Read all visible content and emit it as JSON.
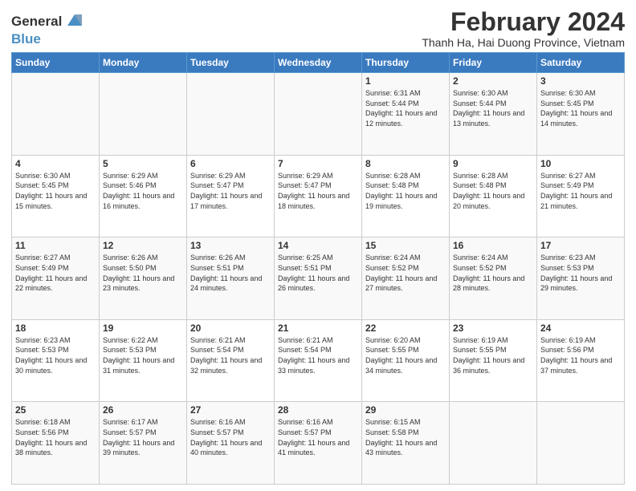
{
  "header": {
    "logo_line1": "General",
    "logo_line2": "Blue",
    "title": "February 2024",
    "subtitle": "Thanh Ha, Hai Duong Province, Vietnam"
  },
  "days_of_week": [
    "Sunday",
    "Monday",
    "Tuesday",
    "Wednesday",
    "Thursday",
    "Friday",
    "Saturday"
  ],
  "weeks": [
    [
      {
        "day": "",
        "sunrise": "",
        "sunset": "",
        "daylight": ""
      },
      {
        "day": "",
        "sunrise": "",
        "sunset": "",
        "daylight": ""
      },
      {
        "day": "",
        "sunrise": "",
        "sunset": "",
        "daylight": ""
      },
      {
        "day": "",
        "sunrise": "",
        "sunset": "",
        "daylight": ""
      },
      {
        "day": "1",
        "sunrise": "6:31 AM",
        "sunset": "5:44 PM",
        "daylight": "11 hours and 12 minutes."
      },
      {
        "day": "2",
        "sunrise": "6:30 AM",
        "sunset": "5:44 PM",
        "daylight": "11 hours and 13 minutes."
      },
      {
        "day": "3",
        "sunrise": "6:30 AM",
        "sunset": "5:45 PM",
        "daylight": "11 hours and 14 minutes."
      }
    ],
    [
      {
        "day": "4",
        "sunrise": "6:30 AM",
        "sunset": "5:45 PM",
        "daylight": "11 hours and 15 minutes."
      },
      {
        "day": "5",
        "sunrise": "6:29 AM",
        "sunset": "5:46 PM",
        "daylight": "11 hours and 16 minutes."
      },
      {
        "day": "6",
        "sunrise": "6:29 AM",
        "sunset": "5:47 PM",
        "daylight": "11 hours and 17 minutes."
      },
      {
        "day": "7",
        "sunrise": "6:29 AM",
        "sunset": "5:47 PM",
        "daylight": "11 hours and 18 minutes."
      },
      {
        "day": "8",
        "sunrise": "6:28 AM",
        "sunset": "5:48 PM",
        "daylight": "11 hours and 19 minutes."
      },
      {
        "day": "9",
        "sunrise": "6:28 AM",
        "sunset": "5:48 PM",
        "daylight": "11 hours and 20 minutes."
      },
      {
        "day": "10",
        "sunrise": "6:27 AM",
        "sunset": "5:49 PM",
        "daylight": "11 hours and 21 minutes."
      }
    ],
    [
      {
        "day": "11",
        "sunrise": "6:27 AM",
        "sunset": "5:49 PM",
        "daylight": "11 hours and 22 minutes."
      },
      {
        "day": "12",
        "sunrise": "6:26 AM",
        "sunset": "5:50 PM",
        "daylight": "11 hours and 23 minutes."
      },
      {
        "day": "13",
        "sunrise": "6:26 AM",
        "sunset": "5:51 PM",
        "daylight": "11 hours and 24 minutes."
      },
      {
        "day": "14",
        "sunrise": "6:25 AM",
        "sunset": "5:51 PM",
        "daylight": "11 hours and 26 minutes."
      },
      {
        "day": "15",
        "sunrise": "6:24 AM",
        "sunset": "5:52 PM",
        "daylight": "11 hours and 27 minutes."
      },
      {
        "day": "16",
        "sunrise": "6:24 AM",
        "sunset": "5:52 PM",
        "daylight": "11 hours and 28 minutes."
      },
      {
        "day": "17",
        "sunrise": "6:23 AM",
        "sunset": "5:53 PM",
        "daylight": "11 hours and 29 minutes."
      }
    ],
    [
      {
        "day": "18",
        "sunrise": "6:23 AM",
        "sunset": "5:53 PM",
        "daylight": "11 hours and 30 minutes."
      },
      {
        "day": "19",
        "sunrise": "6:22 AM",
        "sunset": "5:53 PM",
        "daylight": "11 hours and 31 minutes."
      },
      {
        "day": "20",
        "sunrise": "6:21 AM",
        "sunset": "5:54 PM",
        "daylight": "11 hours and 32 minutes."
      },
      {
        "day": "21",
        "sunrise": "6:21 AM",
        "sunset": "5:54 PM",
        "daylight": "11 hours and 33 minutes."
      },
      {
        "day": "22",
        "sunrise": "6:20 AM",
        "sunset": "5:55 PM",
        "daylight": "11 hours and 34 minutes."
      },
      {
        "day": "23",
        "sunrise": "6:19 AM",
        "sunset": "5:55 PM",
        "daylight": "11 hours and 36 minutes."
      },
      {
        "day": "24",
        "sunrise": "6:19 AM",
        "sunset": "5:56 PM",
        "daylight": "11 hours and 37 minutes."
      }
    ],
    [
      {
        "day": "25",
        "sunrise": "6:18 AM",
        "sunset": "5:56 PM",
        "daylight": "11 hours and 38 minutes."
      },
      {
        "day": "26",
        "sunrise": "6:17 AM",
        "sunset": "5:57 PM",
        "daylight": "11 hours and 39 minutes."
      },
      {
        "day": "27",
        "sunrise": "6:16 AM",
        "sunset": "5:57 PM",
        "daylight": "11 hours and 40 minutes."
      },
      {
        "day": "28",
        "sunrise": "6:16 AM",
        "sunset": "5:57 PM",
        "daylight": "11 hours and 41 minutes."
      },
      {
        "day": "29",
        "sunrise": "6:15 AM",
        "sunset": "5:58 PM",
        "daylight": "11 hours and 43 minutes."
      },
      {
        "day": "",
        "sunrise": "",
        "sunset": "",
        "daylight": ""
      },
      {
        "day": "",
        "sunrise": "",
        "sunset": "",
        "daylight": ""
      }
    ]
  ]
}
